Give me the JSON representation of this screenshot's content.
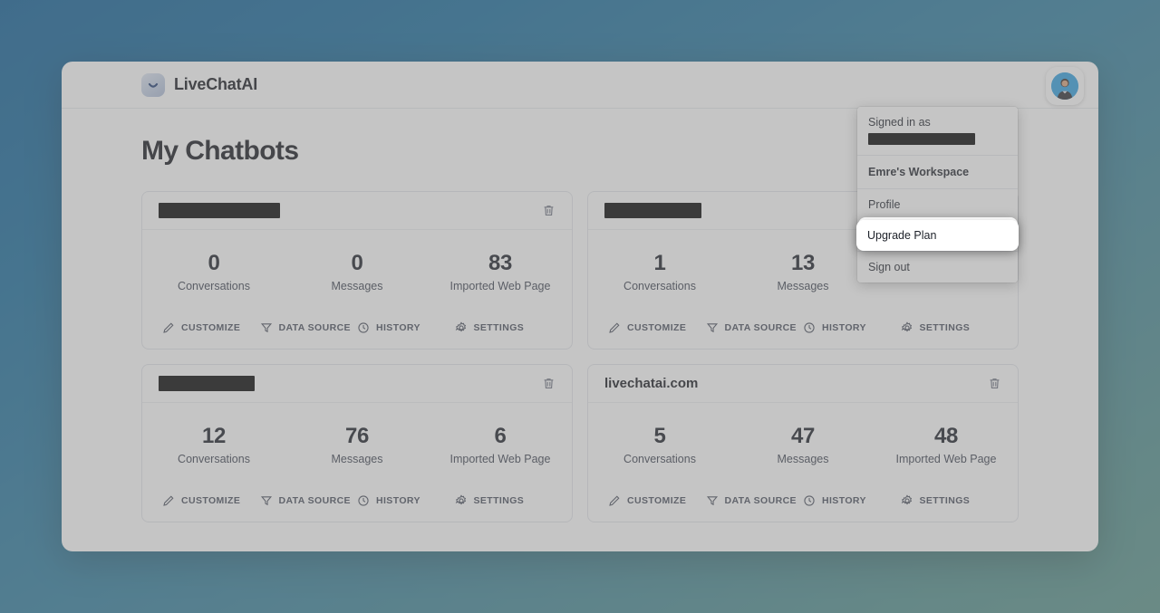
{
  "app": {
    "brand_name": "LiveChatAI",
    "brand_logo_icon": "smile-logo-icon",
    "avatar_icon": "user-avatar"
  },
  "page": {
    "title": "My Chatbots"
  },
  "stat_labels": {
    "conversations": "Conversations",
    "messages": "Messages",
    "imported_web_page": "Imported Web Page"
  },
  "actions": {
    "customize": "CUSTOMIZE",
    "data_source": "DATA SOURCE",
    "history": "HISTORY",
    "settings": "SETTINGS",
    "delete_icon": "trash-icon",
    "customize_icon": "pencil-icon",
    "data_source_icon": "funnel-icon",
    "history_icon": "clock-icon",
    "settings_icon": "gear-icon"
  },
  "chatbots": [
    {
      "title": "",
      "redacted": true,
      "conversations": "0",
      "messages": "0",
      "imported_web_page": "83"
    },
    {
      "title": "",
      "redacted": true,
      "conversations": "1",
      "messages": "13",
      "imported_web_page": ""
    },
    {
      "title": "",
      "redacted": true,
      "conversations": "12",
      "messages": "76",
      "imported_web_page": "6"
    },
    {
      "title": "livechatai.com",
      "redacted": false,
      "conversations": "5",
      "messages": "47",
      "imported_web_page": "48"
    }
  ],
  "user_menu": {
    "signed_in_as_label": "Signed in as",
    "email_redacted": true,
    "workspace": "Emre's Workspace",
    "items": [
      {
        "label": "Profile",
        "highlighted": false
      },
      {
        "label": "Upgrade Plan",
        "highlighted": true
      },
      {
        "label": "Sign out",
        "highlighted": false
      }
    ]
  },
  "colors": {
    "background_start": "#0b5c95",
    "background_end": "#58938a",
    "avatar_bg": "#2f9fe0",
    "text_primary": "#14161c"
  }
}
